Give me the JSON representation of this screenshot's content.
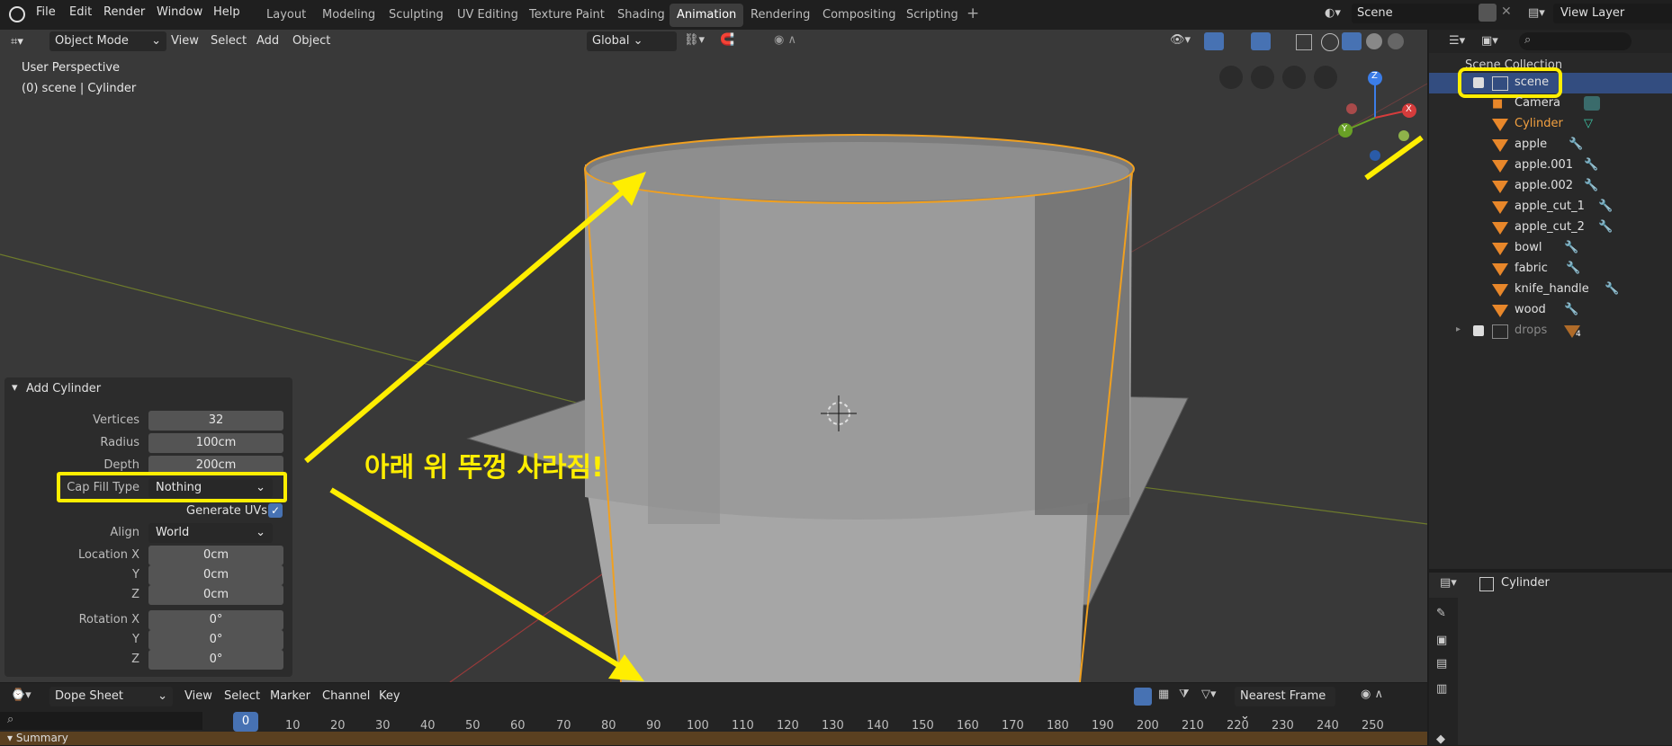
{
  "app_menu": {
    "file": "File",
    "edit": "Edit",
    "render": "Render",
    "window": "Window",
    "help": "Help"
  },
  "workspaces": [
    "Layout",
    "Modeling",
    "Sculpting",
    "UV Editing",
    "Texture Paint",
    "Shading",
    "Animation",
    "Rendering",
    "Compositing",
    "Scripting"
  ],
  "active_workspace": "Animation",
  "scene_field": "Scene",
  "view_layer_field": "View Layer",
  "viewport_header": {
    "mode": "Object Mode",
    "view": "View",
    "select": "Select",
    "add": "Add",
    "object": "Object",
    "transform": "Global"
  },
  "viewport_info": {
    "line1": "User Perspective",
    "line2": "(0) scene | Cylinder"
  },
  "gizmo": {
    "x": "X",
    "y": "Y",
    "z": "Z"
  },
  "annotation_text": "아래 위 뚜껑 사라짐!",
  "outliner": {
    "collection": "Scene Collection",
    "items": [
      {
        "name": "scene"
      },
      {
        "name": "Camera"
      },
      {
        "name": "Cylinder"
      },
      {
        "name": "apple"
      },
      {
        "name": "apple.001"
      },
      {
        "name": "apple.002"
      },
      {
        "name": "apple_cut_1"
      },
      {
        "name": "apple_cut_2"
      },
      {
        "name": "bowl"
      },
      {
        "name": "fabric"
      },
      {
        "name": "knife_handle"
      },
      {
        "name": "wood"
      },
      {
        "name": "drops"
      }
    ],
    "drops_badge": "4"
  },
  "properties": {
    "object_name": "Cylinder"
  },
  "add_cylinder": {
    "title": "Add Cylinder",
    "vertices_label": "Vertices",
    "vertices": "32",
    "radius_label": "Radius",
    "radius": "100cm",
    "depth_label": "Depth",
    "depth": "200cm",
    "cap_fill_label": "Cap Fill Type",
    "cap_fill": "Nothing",
    "generate_uvs_label": "Generate UVs",
    "align_label": "Align",
    "align": "World",
    "location_x_label": "Location X",
    "location_x": "0cm",
    "location_y_label": "Y",
    "location_y": "0cm",
    "location_z_label": "Z",
    "location_z": "0cm",
    "rotation_x_label": "Rotation X",
    "rotation_x": "0°",
    "rotation_y_label": "Y",
    "rotation_y": "0°",
    "rotation_z_label": "Z",
    "rotation_z": "0°"
  },
  "dopesheet": {
    "mode": "Dope Sheet",
    "view": "View",
    "select": "Select",
    "marker": "Marker",
    "channel": "Channel",
    "key": "Key",
    "snap": "Nearest Frame",
    "summary": "Summary",
    "current_frame": "0"
  },
  "timeline_ticks": [
    "10",
    "20",
    "30",
    "40",
    "50",
    "60",
    "70",
    "80",
    "90",
    "100",
    "110",
    "120",
    "130",
    "140",
    "150",
    "160",
    "170",
    "180",
    "190",
    "200",
    "210",
    "220",
    "230",
    "240",
    "250"
  ]
}
